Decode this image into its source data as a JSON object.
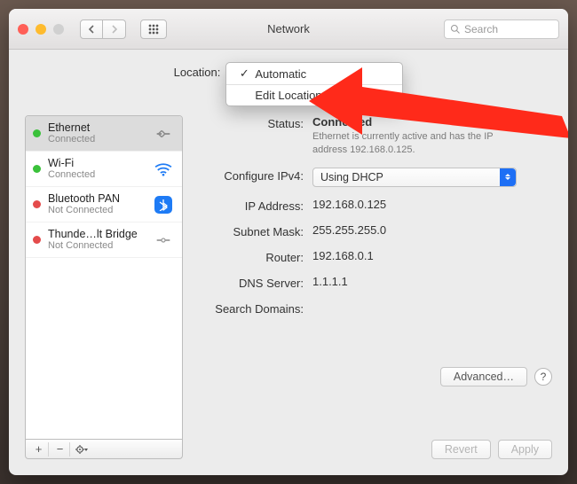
{
  "window": {
    "title": "Network"
  },
  "toolbar": {
    "search_placeholder": "Search"
  },
  "location": {
    "label": "Location:",
    "menu": {
      "automatic": "Automatic",
      "edit": "Edit Locations…"
    }
  },
  "sidebar": {
    "items": [
      {
        "name": "Ethernet",
        "status": "Connected",
        "color": "green",
        "icon": "ethernet"
      },
      {
        "name": "Wi-Fi",
        "status": "Connected",
        "color": "green",
        "icon": "wifi"
      },
      {
        "name": "Bluetooth PAN",
        "status": "Not Connected",
        "color": "red",
        "icon": "bluetooth"
      },
      {
        "name": "Thunde…lt Bridge",
        "status": "Not Connected",
        "color": "red",
        "icon": "thunderbolt"
      }
    ]
  },
  "detail": {
    "status_label": "Status:",
    "status_value": "Connected",
    "status_sub1": "Ethernet is currently active and has the IP",
    "status_sub2": "address 192.168.0.125.",
    "configure_label": "Configure IPv4:",
    "configure_value": "Using DHCP",
    "ip_label": "IP Address:",
    "ip_value": "192.168.0.125",
    "mask_label": "Subnet Mask:",
    "mask_value": "255.255.255.0",
    "router_label": "Router:",
    "router_value": "192.168.0.1",
    "dns_label": "DNS Server:",
    "dns_value": "1.1.1.1",
    "search_label": "Search Domains:",
    "search_value": ""
  },
  "buttons": {
    "advanced": "Advanced…",
    "revert": "Revert",
    "apply": "Apply",
    "help": "?"
  }
}
